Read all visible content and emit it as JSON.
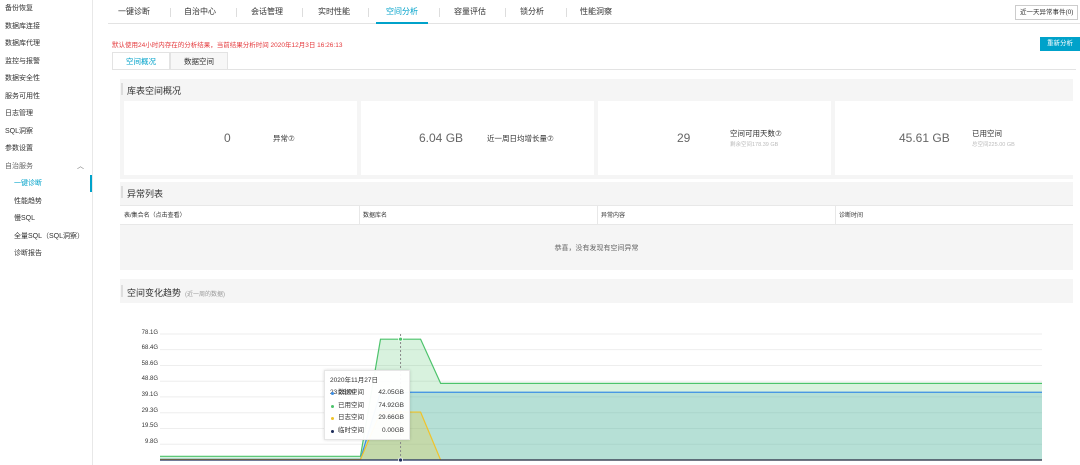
{
  "sidebar": {
    "items": [
      {
        "label": "备份恢复"
      },
      {
        "label": "数据库连接"
      },
      {
        "label": "数据库代理"
      },
      {
        "label": "监控与报警"
      },
      {
        "label": "数据安全性"
      },
      {
        "label": "服务可用性"
      },
      {
        "label": "日志管理"
      },
      {
        "label": "SQL洞察"
      },
      {
        "label": "参数设置"
      },
      {
        "label": "自治服务"
      },
      {
        "label": "一键诊断"
      },
      {
        "label": "性能趋势"
      },
      {
        "label": "慢SQL"
      },
      {
        "label": "全量SQL（SQL洞察）"
      },
      {
        "label": "诊断报告"
      }
    ]
  },
  "tabs": [
    {
      "label": "一键诊断"
    },
    {
      "label": "自治中心"
    },
    {
      "label": "会话管理"
    },
    {
      "label": "实时性能"
    },
    {
      "label": "空间分析"
    },
    {
      "label": "容量评估"
    },
    {
      "label": "锁分析"
    },
    {
      "label": "性能洞察"
    }
  ],
  "anomaly_button": "近一天异常事件(0)",
  "notice": "默认使用24小时内存在的分析结果，当前结果分析时间 2020年12月3日 16:26:13",
  "reanalyze_button": "重新分析",
  "subtabs": [
    {
      "label": "空间概况"
    },
    {
      "label": "数据空间"
    }
  ],
  "overview": {
    "title": "库表空间概况",
    "cards": [
      {
        "value": "0",
        "label": "异常⑦",
        "sub": ""
      },
      {
        "value": "6.04 GB",
        "label": "近一周日均增长量⑦",
        "sub": ""
      },
      {
        "value": "29",
        "label": "空间可用天数⑦",
        "sub": "剩余空间178.39 GB"
      },
      {
        "value": "45.61 GB",
        "label": "已用空间",
        "sub": "总空间225.00 GB"
      }
    ]
  },
  "anomaly_list": {
    "title": "异常列表",
    "headers": [
      "表/集合名（点击查看）",
      "数据库名",
      "异常内容",
      "诊断时间"
    ],
    "empty_text": "恭喜，没有发现有空间异常"
  },
  "trend": {
    "title": "空间变化趋势",
    "note": "(近一周的数据)",
    "y_ticks": [
      "78.1G",
      "68.4G",
      "58.6G",
      "48.8G",
      "39.1G",
      "29.3G",
      "19.5G",
      "9.8G"
    ],
    "tooltip": {
      "time": "2020年11月27日 23:25:00",
      "rows": [
        {
          "name": "数据空间",
          "value": "42.05GB",
          "color": "#3b8ee5"
        },
        {
          "name": "已用空间",
          "value": "74.92GB",
          "color": "#4cc36b"
        },
        {
          "name": "日志空间",
          "value": "29.66GB",
          "color": "#f0c32a"
        },
        {
          "name": "临时空间",
          "value": "0.00GB",
          "color": "#1d2c5a"
        }
      ]
    }
  },
  "chart_data": {
    "type": "area",
    "title": "空间变化趋势",
    "ylim": [
      0,
      80
    ],
    "y_ticks": [
      9.8,
      19.5,
      29.3,
      39.1,
      48.8,
      58.6,
      68.4,
      78.1
    ],
    "series": [
      {
        "name": "已用空间",
        "color": "#4cc36b",
        "values": [
          2.3,
          2.3,
          2.3,
          2.3,
          2.3,
          2.3,
          2.3,
          2.3,
          2.3,
          2.3,
          2.3,
          74.9,
          74.9,
          74.9,
          47.5,
          47.5,
          47.5,
          47.5,
          47.5,
          47.5,
          47.5,
          47.5,
          47.5,
          47.5,
          47.5,
          47.5,
          47.5,
          47.5,
          47.5,
          47.5,
          47.5,
          47.5,
          47.5,
          47.5,
          47.5,
          47.5,
          47.5,
          47.5,
          47.5,
          47.5,
          47.5,
          47.5,
          47.5,
          47.5,
          47.5
        ]
      },
      {
        "name": "数据空间",
        "color": "#3b8ee5",
        "values": [
          0.5,
          0.5,
          0.5,
          0.5,
          0.5,
          0.5,
          0.5,
          0.5,
          0.5,
          0.5,
          0.5,
          42.0,
          42.0,
          42.0,
          42.0,
          42.0,
          42.0,
          42.0,
          42.0,
          42.0,
          42.0,
          42.0,
          42.0,
          42.0,
          42.0,
          42.0,
          42.0,
          42.0,
          42.0,
          42.0,
          42.0,
          42.0,
          42.0,
          42.0,
          42.0,
          42.0,
          42.0,
          42.0,
          42.0,
          42.0,
          42.0,
          42.0,
          42.0,
          42.0,
          42.0
        ]
      },
      {
        "name": "日志空间",
        "color": "#f0c32a",
        "values": [
          0.3,
          0.3,
          0.3,
          0.3,
          0.3,
          0.3,
          0.3,
          0.3,
          0.3,
          0.3,
          0.3,
          29.7,
          29.7,
          29.7,
          0,
          0,
          0,
          0,
          0,
          0,
          0,
          0,
          0,
          0,
          0,
          0,
          0,
          0,
          0,
          0,
          0,
          0,
          0,
          0,
          0,
          0,
          0,
          0,
          0,
          0,
          0,
          0,
          0,
          0,
          0
        ]
      },
      {
        "name": "临时空间",
        "color": "#1d2c5a",
        "values": [
          0,
          0,
          0,
          0,
          0,
          0,
          0,
          0,
          0,
          0,
          0,
          0,
          0,
          0,
          0,
          0,
          0,
          0,
          0,
          0,
          0,
          0,
          0,
          0,
          0,
          0,
          0,
          0,
          0,
          0,
          0,
          0,
          0,
          0,
          0,
          0,
          0,
          0,
          0,
          0,
          0,
          0,
          0,
          0,
          0
        ]
      }
    ]
  },
  "colors": {
    "accent": "#00a2ca",
    "alert": "#e4393c"
  }
}
